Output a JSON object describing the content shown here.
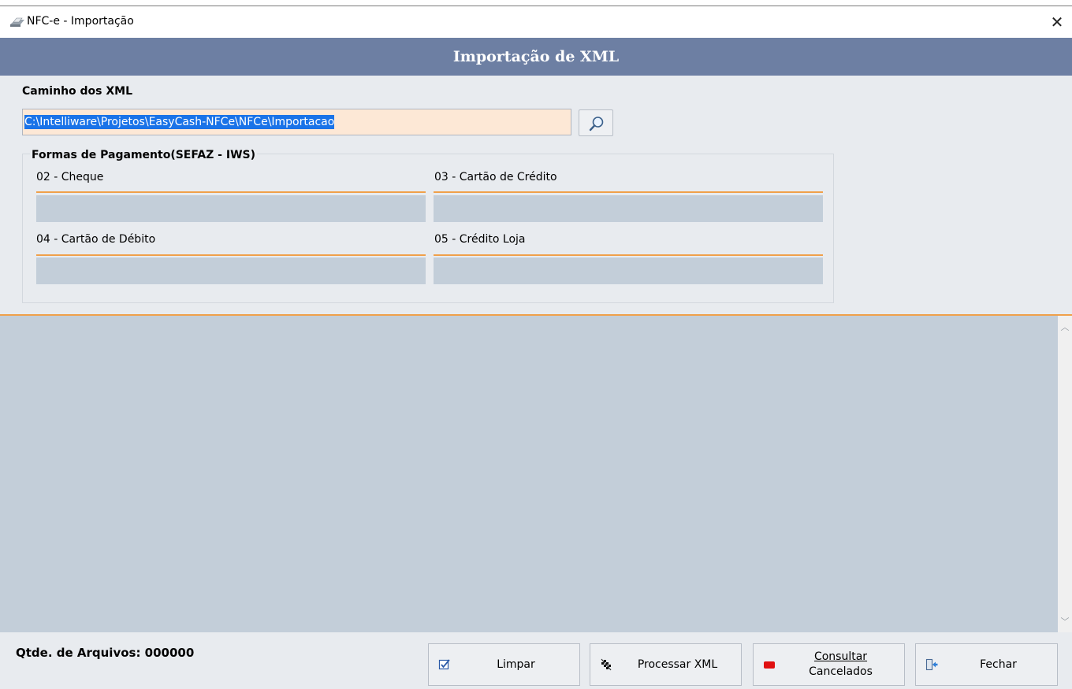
{
  "window": {
    "title": "NFC-e - Importação",
    "close_symbol": "✕"
  },
  "header": {
    "title": "Importação de XML"
  },
  "path": {
    "label": "Caminho dos XML",
    "value": "C:\\Intelliware\\Projetos\\EasyCash-NFCe\\NFCe\\Importacao",
    "search_icon": "magnifier-icon"
  },
  "payments": {
    "group_title": "Formas de Pagamento(SEFAZ - IWS)",
    "items": [
      {
        "label": "02 - Cheque",
        "value": ""
      },
      {
        "label": "03 - Cartão de Crédito",
        "value": ""
      },
      {
        "label": "04 - Cartão de Débito",
        "value": ""
      },
      {
        "label": "05 - Crédito Loja",
        "value": ""
      }
    ]
  },
  "footer": {
    "qtde_label": "Qtde. de Arquivos: 000000",
    "buttons": {
      "limpar": "Limpar",
      "processar": "Processar XML",
      "consultar_line1": "Consultar",
      "consultar_line2": "Cancelados",
      "fechar": "Fechar"
    }
  },
  "colors": {
    "header_band": "#6d7fa3",
    "accent_orange": "#f0a04a",
    "field_bg": "#c3ced9",
    "input_bg": "#fde8d6",
    "selection": "#1a73e8"
  }
}
